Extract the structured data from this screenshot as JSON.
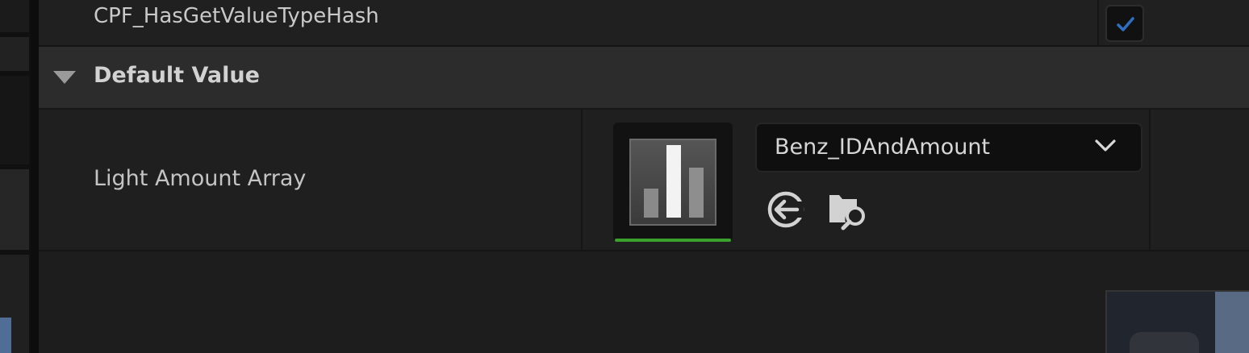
{
  "rows": {
    "flag_row": {
      "label": "CPF_HasGetValueTypeHash",
      "checked": true
    },
    "category": {
      "label": "Default Value",
      "expanded": true
    },
    "property": {
      "label": "Light Amount Array",
      "asset": {
        "selected_value": "Benz_IDAndAmount",
        "thumbnail_icon": "data-table-icon",
        "buttons": [
          {
            "name": "use-selected-icon"
          },
          {
            "name": "browse-to-asset-icon"
          }
        ]
      }
    }
  },
  "colors": {
    "accent_green": "#3aa12c",
    "check_blue": "#2f6fc0",
    "panel_bg": "#1c1c1c",
    "category_bg": "#2c2c2c"
  }
}
